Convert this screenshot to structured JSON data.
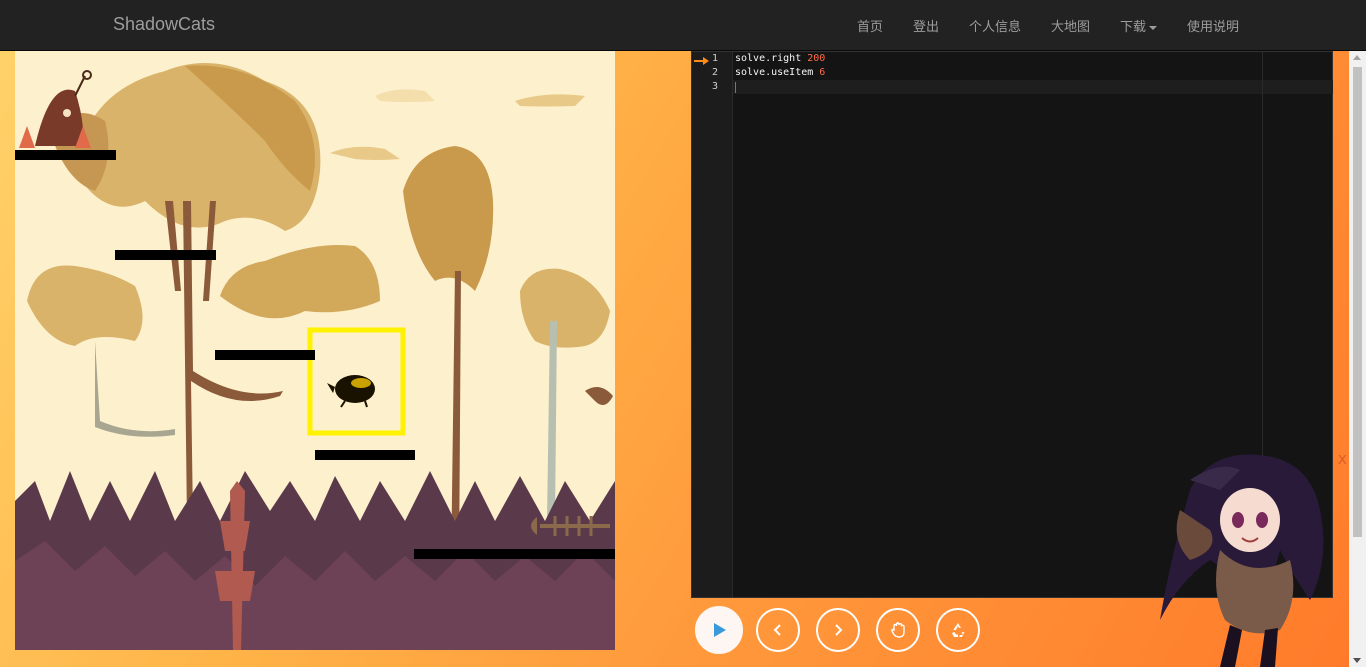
{
  "navbar": {
    "brand": "ShadowCats",
    "items": [
      "首页",
      "登出",
      "个人信息",
      "大地图",
      "下载",
      "使用说明"
    ]
  },
  "editor": {
    "lines": [
      {
        "num": "1",
        "code": "solve.right ",
        "arg": "200"
      },
      {
        "num": "2",
        "code": "solve.useItem ",
        "arg": "6"
      },
      {
        "num": "3",
        "code": "",
        "arg": ""
      }
    ]
  },
  "controls": {
    "buttons": [
      "play-icon",
      "chevron-left-icon",
      "chevron-right-icon",
      "hand-icon",
      "recycle-icon"
    ]
  },
  "mascot_close": "X",
  "colors": {
    "navbar_bg": "#222222",
    "nav_text": "#9d9d9d",
    "editor_bg": "#141414",
    "number_token": "#ff6b4a",
    "highlight_box": "#fff200",
    "play_icon": "#3a9ad9"
  }
}
